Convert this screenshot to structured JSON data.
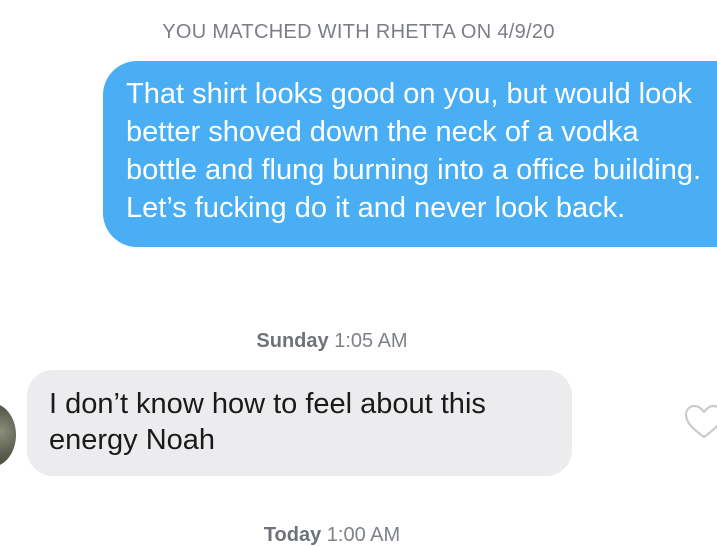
{
  "chat": {
    "match_notice": "YOU MATCHED WITH RHETTA ON 4/9/20",
    "messages": [
      {
        "direction": "outgoing",
        "text": "That shirt looks good on you, but would look better shoved down the neck of a vodka bottle and flung burning into a office building. Let’s fucking do it and never look back."
      },
      {
        "direction": "incoming",
        "text": "I don’t know how to feel about this energy Noah"
      }
    ],
    "timestamps": [
      {
        "day": "Sunday",
        "time": "1:05 AM"
      },
      {
        "day": "Today",
        "time": "1:00 AM"
      }
    ]
  },
  "icons": {
    "like": "heart-outline-icon",
    "avatar": "avatar"
  },
  "colors": {
    "outgoing_bubble": "#4aaef5",
    "incoming_bubble": "#ececee",
    "muted_text": "#7b7f85"
  }
}
